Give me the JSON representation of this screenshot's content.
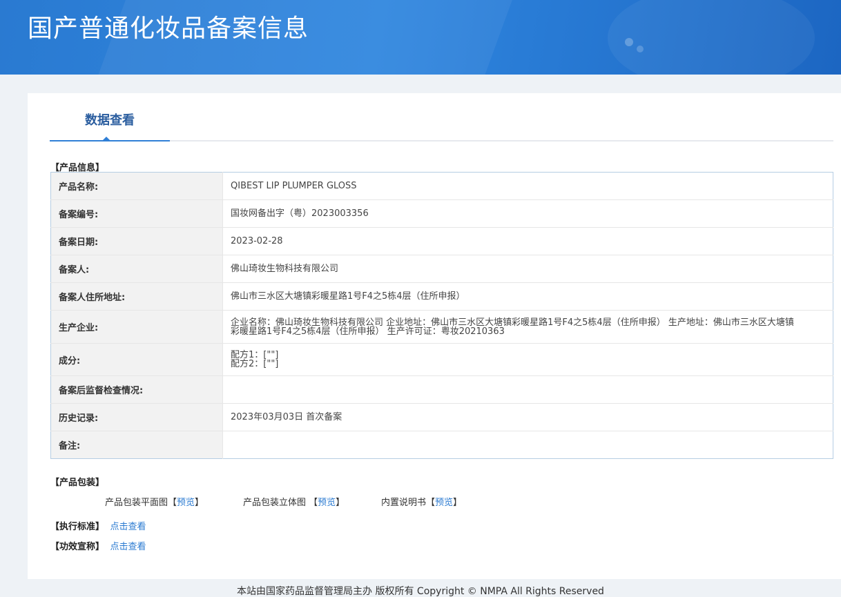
{
  "header": {
    "title": "国产普通化妆品备案信息"
  },
  "tabs": [
    {
      "label": "数据查看"
    }
  ],
  "sections": {
    "product_info": "【产品信息】",
    "packaging": "【产品包装】",
    "standard": "【执行标准】",
    "efficacy": "【功效宣称】"
  },
  "product_info": {
    "rows": [
      {
        "label": "产品名称:",
        "value": "QIBEST LIP PLUMPER GLOSS"
      },
      {
        "label": "备案编号:",
        "value": "国妆网备出字（粤）2023003356"
      },
      {
        "label": "备案日期:",
        "value": "2023-02-28"
      },
      {
        "label": "备案人:",
        "value": "佛山琦妆生物科技有限公司"
      },
      {
        "label": "备案人住所地址:",
        "value": "佛山市三水区大塘镇彩暖星路1号F4之5栋4层（住所申报）"
      },
      {
        "label": "生产企业:",
        "value": "企业名称：佛山琦妆生物科技有限公司 企业地址：佛山市三水区大塘镇彩暖星路1号F4之5栋4层（住所申报） 生产地址：佛山市三水区大塘镇彩暖星路1号F4之5栋4层（住所申报） 生产许可证：粤妆20210363"
      },
      {
        "label": "成分:",
        "value_lines": [
          "配方1：[\"\"]",
          "配方2：[\"\"]"
        ]
      },
      {
        "label": "备案后监督检查情况:",
        "value": ""
      },
      {
        "label": "历史记录:",
        "value": "2023年03月03日 首次备案"
      },
      {
        "label": "备注:",
        "value": ""
      }
    ]
  },
  "packaging": {
    "items": [
      {
        "label": "产品包装平面图",
        "bracket_open": "【",
        "link": "预览",
        "bracket_close": "】"
      },
      {
        "label": "产品包装立体图 ",
        "bracket_open": "【",
        "link": "预览",
        "bracket_close": "】"
      },
      {
        "label": "内置说明书",
        "bracket_open": "【",
        "link": "预览",
        "bracket_close": "】"
      }
    ]
  },
  "standard_link": "点击查看",
  "efficacy_link": "点击查看",
  "footer": {
    "text": "本站由国家药品监督管理局主办 版权所有 Copyright © NMPA All Rights Reserved"
  },
  "colors": {
    "header_blue": "#2a7ad1",
    "link": "#2a7ad1",
    "tab_text": "#2a5d9f"
  }
}
